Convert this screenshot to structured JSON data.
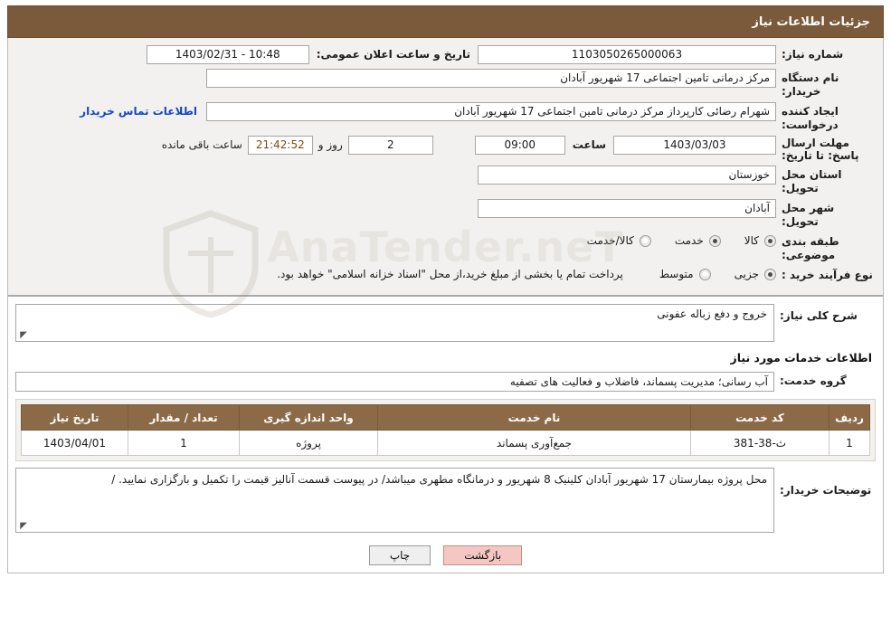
{
  "header": {
    "title": "جزئیات اطلاعات نیاز"
  },
  "form": {
    "need_number_label": "شماره نیاز:",
    "need_number_value": "1103050265000063",
    "announce_datetime_label": "تاریخ و ساعت اعلان عمومی:",
    "announce_datetime_value": "10:48 - 1403/02/31",
    "buyer_org_label": "نام دستگاه خریدار:",
    "buyer_org_value": "مرکز درمانی تامین اجتماعی 17 شهریور آبادان",
    "requester_label": "ایجاد کننده درخواست:",
    "requester_value": "شهرام رضائی کارپرداز مرکز درمانی تامین اجتماعی 17 شهریور آبادان",
    "contact_link": "اطلاعات تماس خریدار",
    "deadline_label": "مهلت ارسال پاسخ: تا تاریخ:",
    "deadline_date": "1403/03/03",
    "time_label": "ساعت",
    "deadline_time": "09:00",
    "remaining_days": "2",
    "remaining_days_label": "روز و",
    "remaining_clock": "21:42:52",
    "remaining_suffix": "ساعت باقی مانده",
    "province_label": "استان محل تحویل:",
    "province_value": "خوزستان",
    "city_label": "شهر محل تحویل:",
    "city_value": "آبادان",
    "category_label": "طبقه بندی موضوعی:",
    "category_options": [
      {
        "label": "کالا",
        "checked": true
      },
      {
        "label": "خدمت",
        "checked": true
      },
      {
        "label": "کالا/خدمت",
        "checked": false
      }
    ],
    "process_label": "نوع فرآیند خرید :",
    "process_options": [
      {
        "label": "جزیی",
        "checked": true
      },
      {
        "label": "متوسط",
        "checked": false
      }
    ],
    "process_note": "پرداخت تمام یا بخشی از مبلغ خرید،از محل \"اسناد خزانه اسلامی\" خواهد بود."
  },
  "details": {
    "summary_label": "شرح کلی نیاز:",
    "summary_value": "خروج و دفع زباله عفونی",
    "services_head": "اطلاعات خدمات مورد نیاز",
    "service_group_label": "گروه خدمت:",
    "service_group_value": "آب رسانی؛ مدیریت پسماند، فاضلاب و فعالیت های تصفیه",
    "table": {
      "columns": [
        "ردیف",
        "کد خدمت",
        "نام خدمت",
        "واحد اندازه گیری",
        "تعداد / مقدار",
        "تاریخ نیاز"
      ],
      "rows": [
        [
          "1",
          "ث-38-381",
          "جمع‌آوری پسماند",
          "پروژه",
          "1",
          "1403/04/01"
        ]
      ]
    },
    "buyer_notes_label": "توضیحات خریدار:",
    "buyer_notes_value": "محل پروژه بیمارستان 17 شهریور آبادان کلینیک 8 شهریور و درمانگاه مطهری میباشد/ در پیوست قسمت آنالیز قیمت را تکمیل و بارگزاری نمایید. /"
  },
  "footer": {
    "print_label": "چاپ",
    "back_label": "بازگشت"
  },
  "watermark": {
    "text": "AnaTender.neT"
  }
}
